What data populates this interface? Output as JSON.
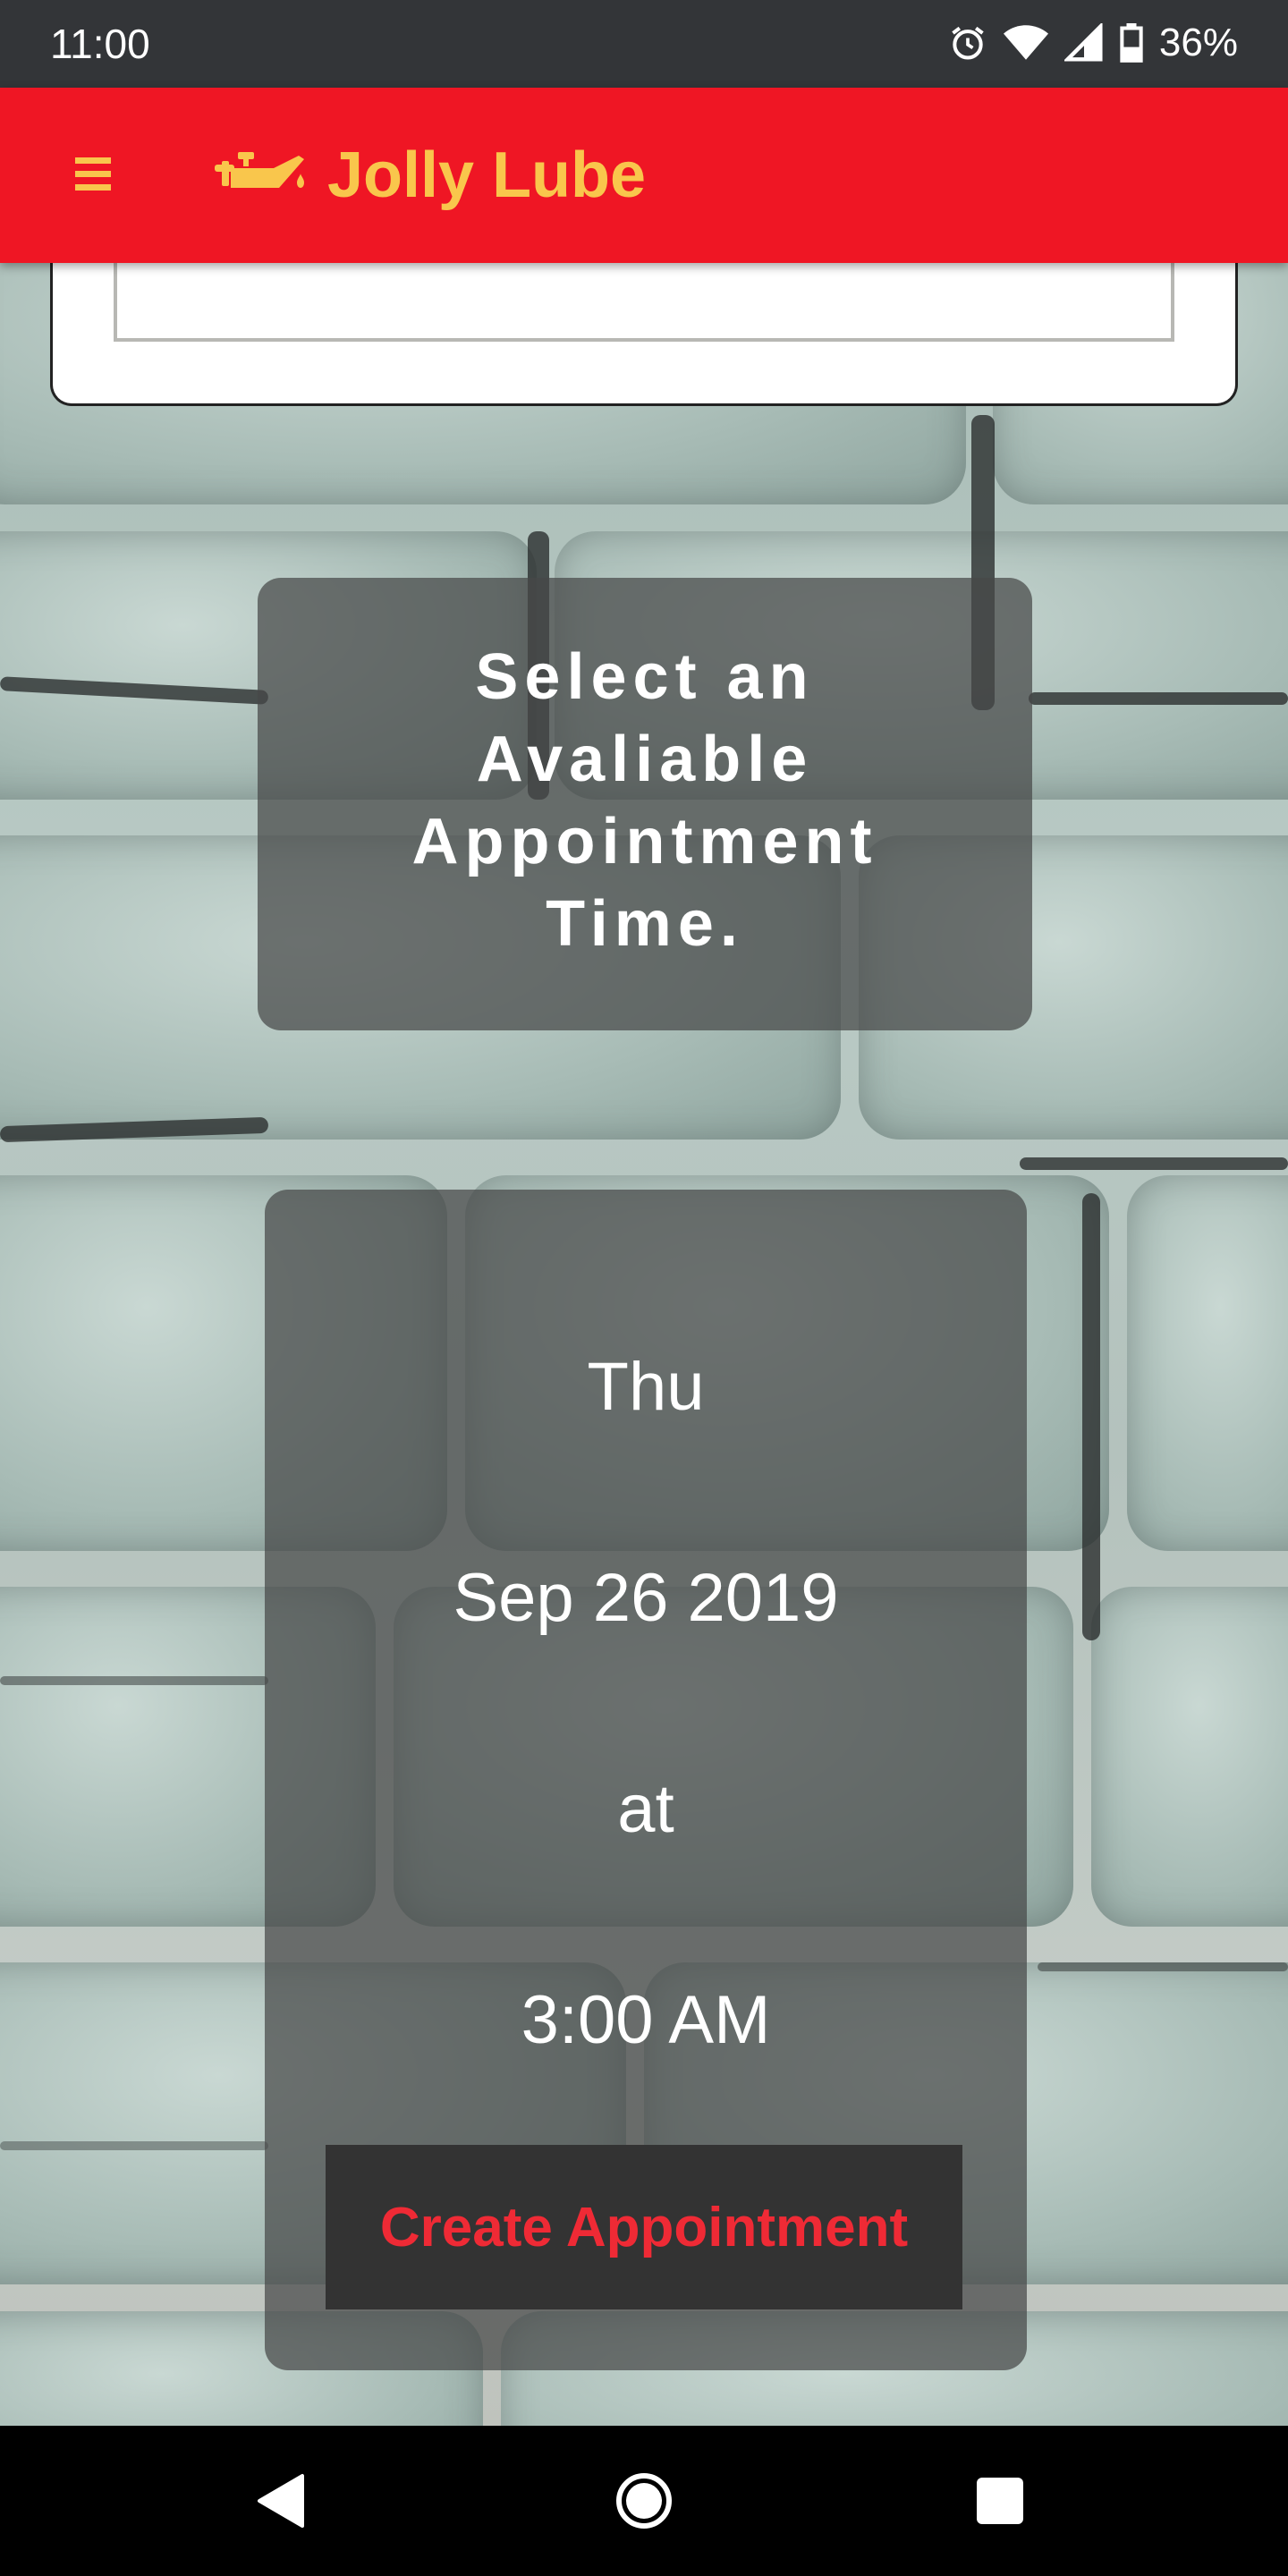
{
  "status_bar": {
    "time": "11:00",
    "battery_percent": "36%",
    "icons": [
      "alarm-icon",
      "wifi-icon",
      "signal-icon",
      "battery-icon"
    ]
  },
  "app_bar": {
    "menu_icon": "hamburger-menu-icon",
    "logo_icon": "oil-can-icon",
    "title": "Jolly Lube",
    "background_color": "#ef1624",
    "accent_color": "#f9c64c"
  },
  "header": {
    "text": "Select an Avaliable Appointment Time."
  },
  "appointment": {
    "day": "Thu",
    "date": "Sep 26 2019",
    "connector": "at",
    "time": "3:00 AM",
    "create_button_label": "Create Appointment",
    "button_text_color": "#ef2a35"
  },
  "nav_bar": {
    "back_icon": "back-triangle-icon",
    "home_icon": "home-circle-icon",
    "recents_icon": "recents-square-icon"
  }
}
